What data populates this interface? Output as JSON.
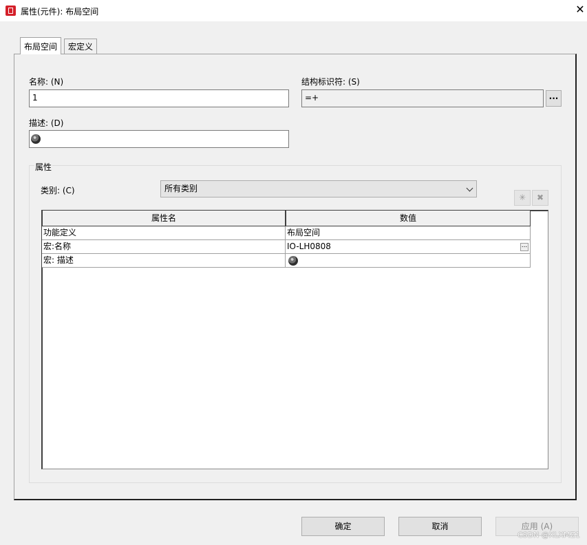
{
  "window": {
    "title": "属性(元件): 布局空间",
    "close_symbol": "✕",
    "app_icon": "app-icon"
  },
  "tabs": [
    {
      "label": "布局空间",
      "active": true
    },
    {
      "label": "宏定义",
      "active": false
    }
  ],
  "fields": {
    "name_label": "名称: (N)",
    "name_value": "1",
    "structure_label": "结构标识符: (S)",
    "structure_value": "=+",
    "structure_button": "...",
    "description_label": "描述: (D)",
    "description_icon": "globe-icon"
  },
  "properties": {
    "group_title": "属性",
    "category_label": "类别: (C)",
    "category_value": "所有类别",
    "add_button_icon": "star-icon",
    "delete_button_icon": "delete-icon",
    "columns": [
      "属性名",
      "数值"
    ],
    "rows": [
      {
        "name": "功能定义",
        "value": "布局空间"
      },
      {
        "name": "宏:名称",
        "value": "IO-LH0808",
        "has_ellipsis": true
      },
      {
        "name": "宏: 描述",
        "value": "",
        "icon": "globe-icon"
      }
    ],
    "row_ellipsis": "..."
  },
  "buttons": {
    "ok": "确定",
    "cancel": "取消",
    "apply": "应用 (A)"
  },
  "watermark": "CSDN @XLXMZ1",
  "colors": {
    "app_icon": "#d4202a"
  }
}
